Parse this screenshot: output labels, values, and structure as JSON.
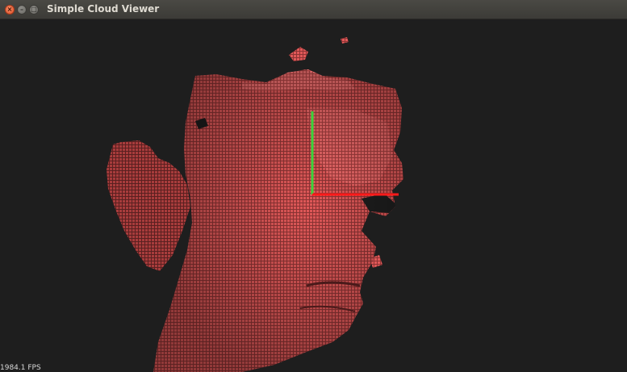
{
  "window": {
    "title": "Simple Cloud Viewer",
    "controls": {
      "close_glyph": "×",
      "minimize_glyph": "–",
      "maximize_glyph": "□"
    }
  },
  "viewer": {
    "fps_label": "1984.1 FPS",
    "background_color": "#1e1e1e",
    "cloud_color": "#e05656",
    "axes": {
      "x_color": "#ff1a1a",
      "y_color": "#3bd43b"
    }
  }
}
